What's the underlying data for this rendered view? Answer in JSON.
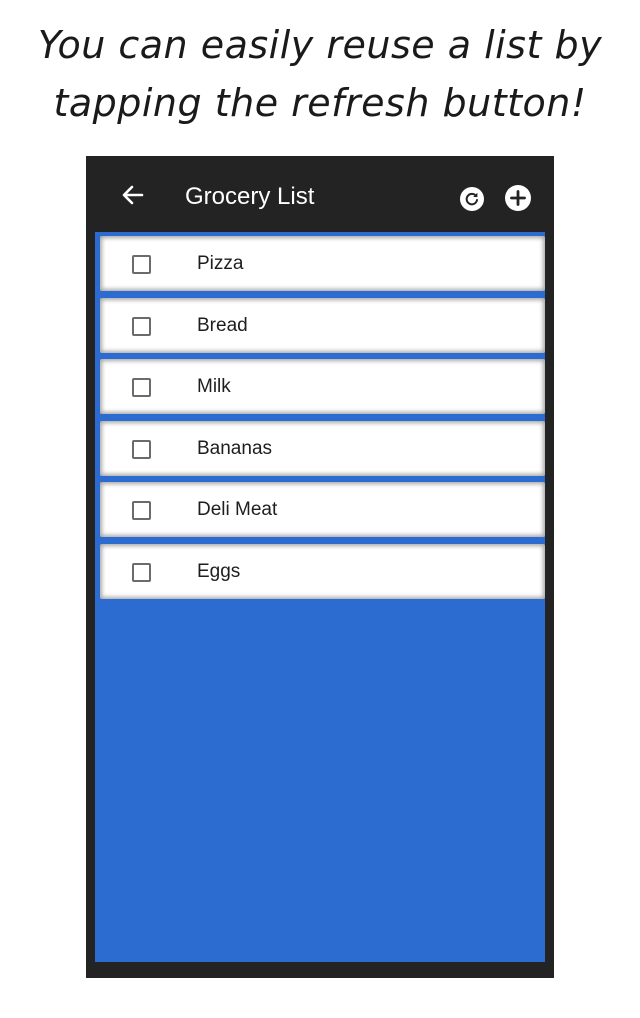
{
  "caption": {
    "line1": "You can easily reuse a list by",
    "line2": "tapping the refresh button!"
  },
  "appbar": {
    "title": "Grocery List",
    "back_icon": "arrow-left",
    "refresh_icon": "refresh-circle",
    "add_icon": "add-circle",
    "background_color": "#232323"
  },
  "list": {
    "background_color": "#2c6bcf",
    "items": [
      {
        "label": "Pizza",
        "checked": false
      },
      {
        "label": "Bread",
        "checked": false
      },
      {
        "label": "Milk",
        "checked": false
      },
      {
        "label": "Bananas",
        "checked": false
      },
      {
        "label": "Deli Meat",
        "checked": false
      },
      {
        "label": "Eggs",
        "checked": false
      }
    ]
  }
}
